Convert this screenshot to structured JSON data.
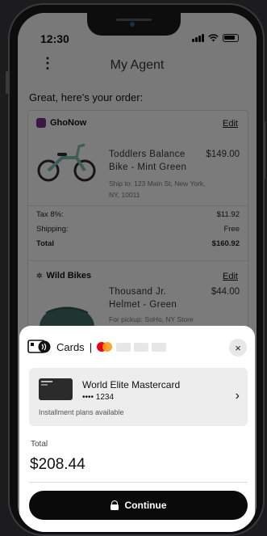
{
  "status_bar": {
    "time": "12:30"
  },
  "app": {
    "title": "My Agent",
    "menu_glyph": "⋮"
  },
  "greeting": "Great, here's your order:",
  "order": {
    "merchants": [
      {
        "name": "GhoNow",
        "edit_label": "Edit",
        "product": {
          "name": "Toddlers Balance Bike  - Mint Green",
          "price": "$149.00",
          "note": "Ship to: 123 Main St, New York, NY, 10011"
        },
        "summary": [
          {
            "label": "Tax 8%:",
            "value": "$11.92"
          },
          {
            "label": "Shipping:",
            "value": "Free"
          },
          {
            "label": "Total",
            "value": "$160.92"
          }
        ]
      },
      {
        "name": "Wild Bikes",
        "edit_label": "Edit",
        "product": {
          "name": "Thousand Jr. Helmet  - Green",
          "price": "$44.00",
          "note": "For pickup: SoHo, NY Store"
        }
      }
    ]
  },
  "payment_sheet": {
    "method_label": "Cards",
    "separator": "|",
    "close_glyph": "×",
    "card": {
      "name": "World Elite Mastercard",
      "number": "•••• 1234",
      "installment_text": "Installment plans available",
      "chevron": "›"
    },
    "total_label": "Total",
    "total_value": "$208.44",
    "continue_label": "Continue"
  },
  "colors": {
    "overlay": "rgba(0,0,0,0.5)",
    "continue_button": "#0a0a0a",
    "mastercard_red": "#eb001b",
    "mastercard_orange": "#f79e1b",
    "helmet": "#3f6b5e",
    "bike": "#7fb8a8"
  },
  "icons": [
    "menu-dots-icon",
    "signal-icon",
    "wifi-icon",
    "battery-icon",
    "merchant-logo-icon",
    "bike-image",
    "helmet-image",
    "card-reader-icon",
    "mastercard-logo",
    "close-icon",
    "chevron-right-icon",
    "lock-icon"
  ]
}
